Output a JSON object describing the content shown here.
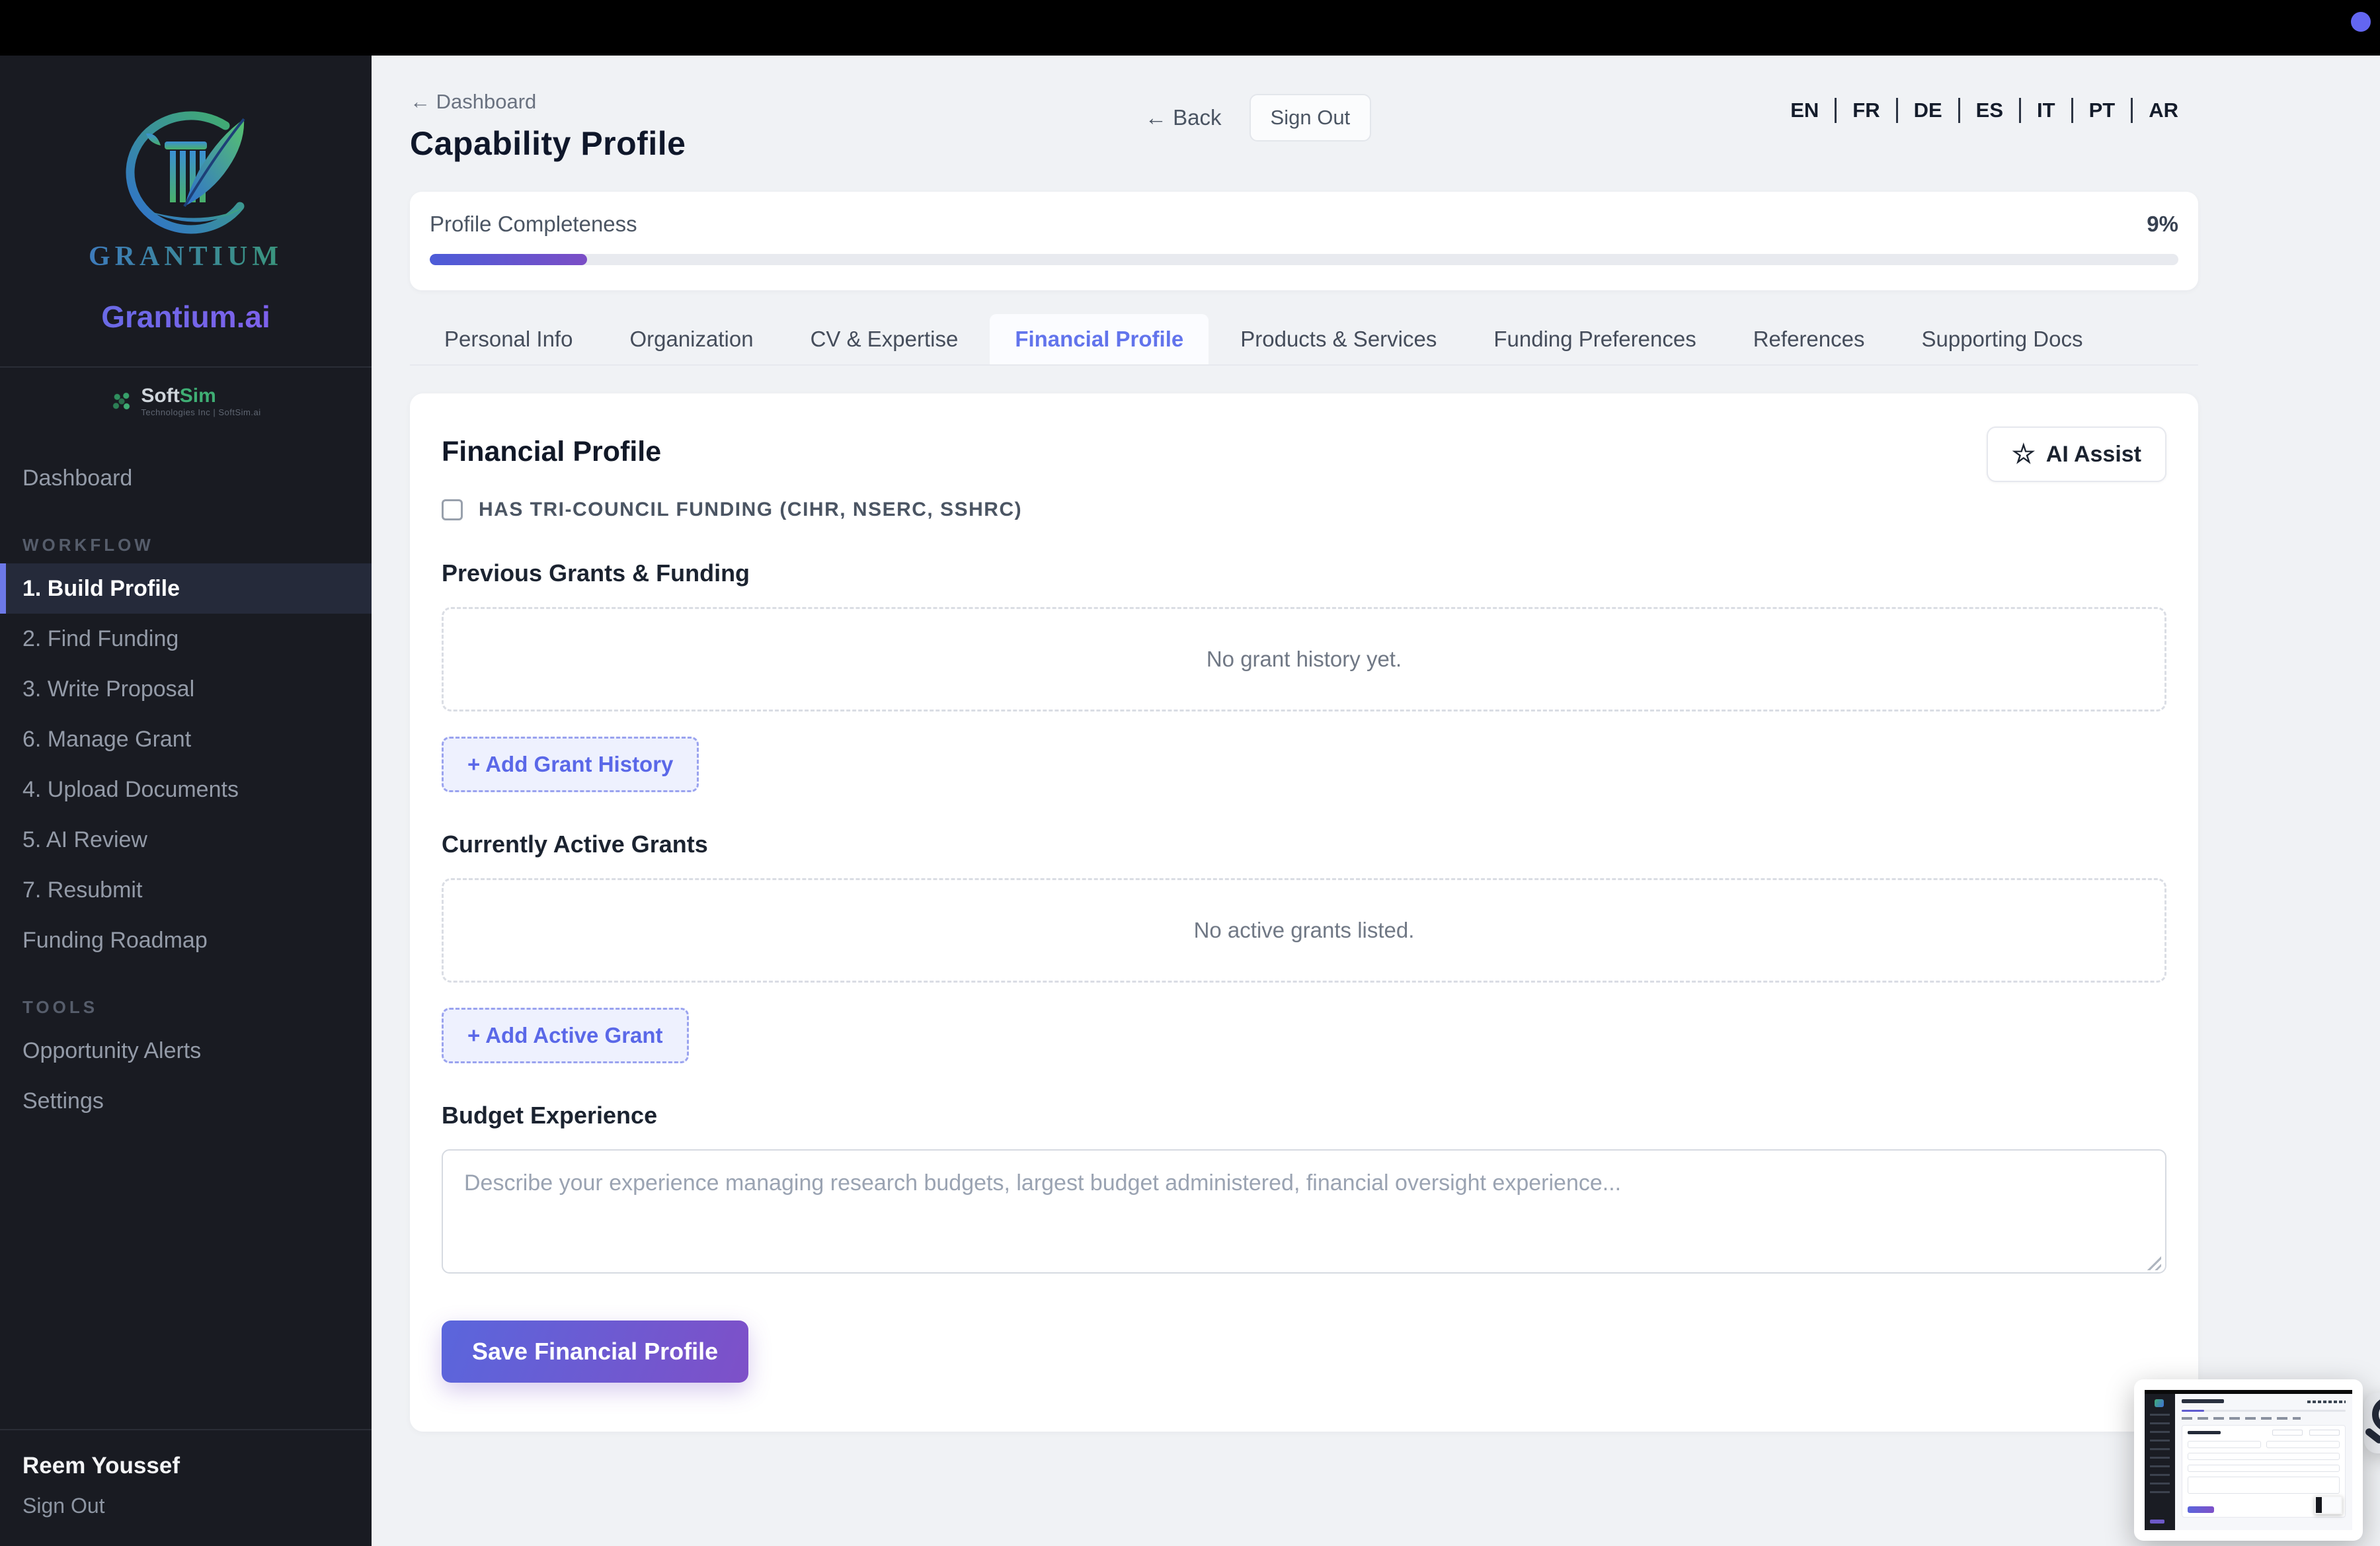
{
  "topbar": {
    "recording_dot_color": "#6366f1"
  },
  "sidebar": {
    "brand": {
      "logo_word": "GRANTIUM",
      "app_name": "Grantium.ai",
      "partner_name_a": "Soft",
      "partner_name_b": "Sim",
      "partner_tagline": "Technologies Inc | SoftSim.ai"
    },
    "dashboard": "Dashboard",
    "workflow": {
      "label": "WORKFLOW",
      "items": [
        {
          "label": "1. Build Profile",
          "active": true
        },
        {
          "label": "2. Find Funding"
        },
        {
          "label": "3. Write Proposal"
        },
        {
          "label": "6. Manage Grant"
        },
        {
          "label": "4. Upload Documents"
        },
        {
          "label": "5. AI Review"
        },
        {
          "label": "7. Resubmit"
        },
        {
          "label": "Funding Roadmap"
        }
      ]
    },
    "tools": {
      "label": "TOOLS",
      "items": [
        {
          "label": "Opportunity Alerts"
        },
        {
          "label": "Settings"
        }
      ]
    },
    "user": {
      "name": "Reem Youssef",
      "sign_out": "Sign Out"
    }
  },
  "header": {
    "breadcrumb_arrow": "←",
    "breadcrumb": "Dashboard",
    "title": "Capability Profile",
    "back_arrow": "←",
    "back_label": "Back",
    "sign_out_label": "Sign Out",
    "languages": [
      "EN",
      "FR",
      "DE",
      "ES",
      "IT",
      "PT",
      "AR"
    ]
  },
  "progress": {
    "label": "Profile Completeness",
    "value_label": "9%",
    "percent": 9
  },
  "tabs": {
    "items": [
      {
        "label": "Personal Info"
      },
      {
        "label": "Organization"
      },
      {
        "label": "CV & Expertise"
      },
      {
        "label": "Financial Profile",
        "active": true
      },
      {
        "label": "Products & Services"
      },
      {
        "label": "Funding Preferences"
      },
      {
        "label": "References"
      },
      {
        "label": "Supporting Docs"
      }
    ]
  },
  "panel": {
    "heading": "Financial Profile",
    "ai_assist": {
      "icon": "☆",
      "label": "AI Assist"
    },
    "tri_council": {
      "checked": false,
      "label": "HAS TRI-COUNCIL FUNDING (CIHR, NSERC, SSHRC)"
    },
    "previous_grants": {
      "heading": "Previous Grants & Funding",
      "empty_text": "No grant history yet.",
      "add_label": "+ Add Grant History"
    },
    "active_grants": {
      "heading": "Currently Active Grants",
      "empty_text": "No active grants listed.",
      "add_label": "+ Add Active Grant"
    },
    "budget": {
      "heading": "Budget Experience",
      "placeholder": "Describe your experience managing research budgets, largest budget administered, financial oversight experience..."
    },
    "save_label": "Save Financial Profile"
  },
  "colors": {
    "accent_indigo": "#6366f1",
    "progress_gradient_from": "#4c5cd8",
    "progress_gradient_to": "#7b4ec6",
    "save_gradient_from": "#5a66dc",
    "save_gradient_to": "#7e50c8",
    "sidebar_bg": "#191b22",
    "page_bg": "#f0f2f5"
  }
}
